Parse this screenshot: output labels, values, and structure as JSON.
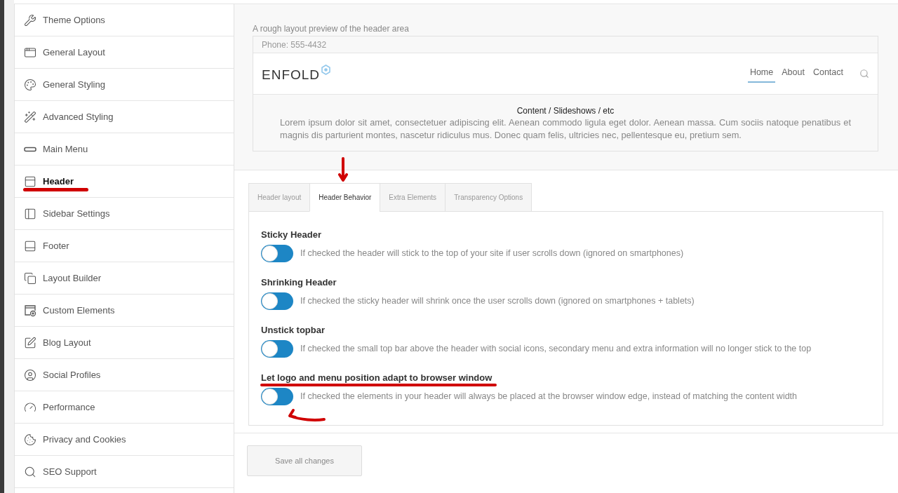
{
  "sidebar": {
    "items": [
      {
        "label": "Theme Options",
        "selected": false
      },
      {
        "label": "General Layout",
        "selected": false
      },
      {
        "label": "General Styling",
        "selected": false
      },
      {
        "label": "Advanced Styling",
        "selected": false
      },
      {
        "label": "Main Menu",
        "selected": false
      },
      {
        "label": "Header",
        "selected": true
      },
      {
        "label": "Sidebar Settings",
        "selected": false
      },
      {
        "label": "Footer",
        "selected": false
      },
      {
        "label": "Layout Builder",
        "selected": false
      },
      {
        "label": "Custom Elements",
        "selected": false
      },
      {
        "label": "Blog Layout",
        "selected": false
      },
      {
        "label": "Social Profiles",
        "selected": false
      },
      {
        "label": "Performance",
        "selected": false
      },
      {
        "label": "Privacy and Cookies",
        "selected": false
      },
      {
        "label": "SEO Support",
        "selected": false
      }
    ]
  },
  "preview": {
    "caption": "A rough layout preview of the header area",
    "topbar_text": "Phone: 555-4432",
    "logo": "ENFOLD",
    "nav": [
      {
        "label": "Home",
        "selected": true
      },
      {
        "label": "About",
        "selected": false
      },
      {
        "label": "Contact",
        "selected": false
      }
    ],
    "content_title": "Content / Slideshows / etc",
    "content_text": "Lorem ipsum dolor sit amet, consectetuer adipiscing elit. Aenean commodo ligula eget dolor. Aenean massa. Cum sociis natoque penatibus et magnis dis parturient montes, nascetur ridiculus mus. Donec quam felis, ultricies nec, pellentesque eu, pretium sem."
  },
  "header_behavior": {
    "tabs": [
      {
        "label": "Header layout",
        "selected": false
      },
      {
        "label": "Header Behavior",
        "selected": true
      },
      {
        "label": "Extra Elements",
        "selected": false
      },
      {
        "label": "Transparency Options",
        "selected": false
      }
    ],
    "settings": [
      {
        "label": "Sticky Header",
        "on": false,
        "description": "If checked the header will stick to the top of your site if user scrolls down (ignored on smartphones)"
      },
      {
        "label": "Shrinking Header",
        "on": false,
        "description": "If checked the sticky header will shrink once the user scrolls down (ignored on smartphones + tablets)"
      },
      {
        "label": "Unstick topbar",
        "on": false,
        "description": "If checked the small top bar above the header with social icons, secondary menu and extra information will no longer stick to the top"
      },
      {
        "label": "Let logo and menu position adapt to browser window",
        "on": false,
        "description": "If checked the elements in your header will always be placed at the browser window edge, instead of matching the content width"
      }
    ]
  },
  "save_button": "Save all changes"
}
